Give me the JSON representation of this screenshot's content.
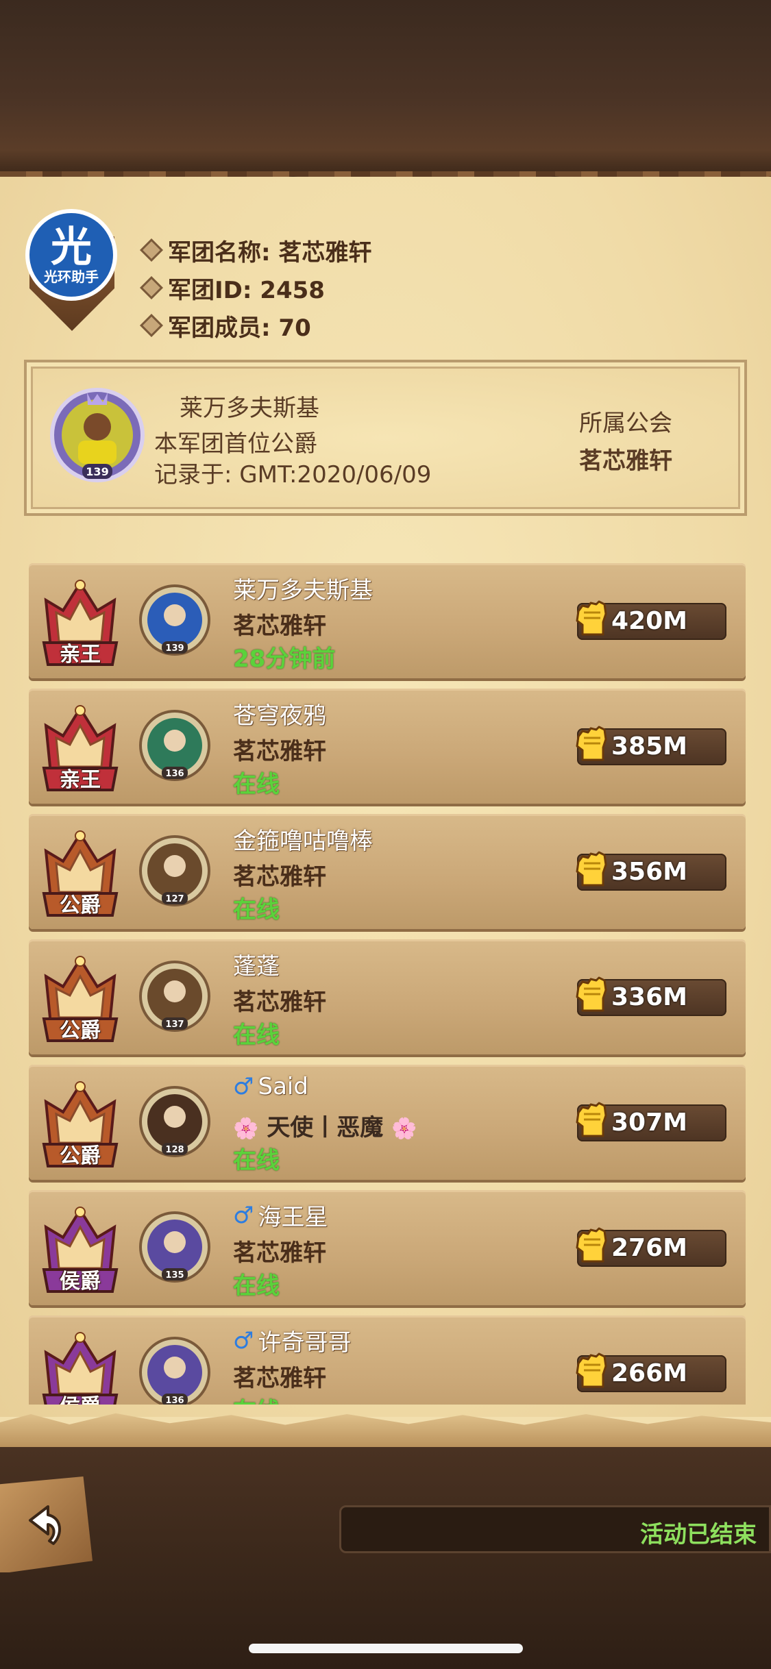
{
  "guild": {
    "emblem_char": "光",
    "emblem_text": "光环助手",
    "name_line": "军团名称: 茗芯雅轩",
    "id_line": "军团ID: 2458",
    "members_line": "军团成员: 70"
  },
  "first_duke": {
    "name": "莱万多夫斯基",
    "title": "本军团首位公爵",
    "recorded": "记录于: GMT:2020/06/09",
    "guild_label": "所属公会",
    "guild_name": "茗芯雅轩",
    "level": "139"
  },
  "members": [
    {
      "rank": "亲王",
      "rank_color": "#c0303a",
      "name": "莱万多夫斯基",
      "male": false,
      "guild": "茗芯雅轩",
      "status": "28分钟前",
      "power": "420M",
      "level": "139",
      "avatar_color": "#2b5db8"
    },
    {
      "rank": "亲王",
      "rank_color": "#c0303a",
      "name": "苍穹夜鸦",
      "male": false,
      "guild": "茗芯雅轩",
      "status": "在线",
      "power": "385M",
      "level": "136",
      "avatar_color": "#2e7a5a"
    },
    {
      "rank": "公爵",
      "rank_color": "#b85a2a",
      "name": "金箍噜咕噜棒",
      "male": false,
      "guild": "茗芯雅轩",
      "status": "在线",
      "power": "356M",
      "level": "127",
      "avatar_color": "#6a4a2c"
    },
    {
      "rank": "公爵",
      "rank_color": "#b85a2a",
      "name": "蓬蓬",
      "male": false,
      "guild": "茗芯雅轩",
      "status": "在线",
      "power": "336M",
      "level": "137",
      "avatar_color": "#6a4a2c"
    },
    {
      "rank": "公爵",
      "rank_color": "#b85a2a",
      "name": "Said",
      "male": true,
      "guild": "天使丨恶魔",
      "guild_flowers": true,
      "status": "在线",
      "power": "307M",
      "level": "128",
      "avatar_color": "#4a3020"
    },
    {
      "rank": "侯爵",
      "rank_color": "#8a3a9a",
      "name": "海王星",
      "male": true,
      "guild": "茗芯雅轩",
      "status": "在线",
      "power": "276M",
      "level": "135",
      "avatar_color": "#5a4aa0"
    },
    {
      "rank": "侯爵",
      "rank_color": "#8a3a9a",
      "name": "许奇哥哥",
      "male": true,
      "guild": "茗芯雅轩",
      "status": "在线",
      "power": "266M",
      "level": "136",
      "avatar_color": "#5a4aa0"
    }
  ],
  "footer": {
    "event_status": "活动已结束"
  },
  "icons": {
    "male": "♂",
    "flower": "🌸"
  }
}
